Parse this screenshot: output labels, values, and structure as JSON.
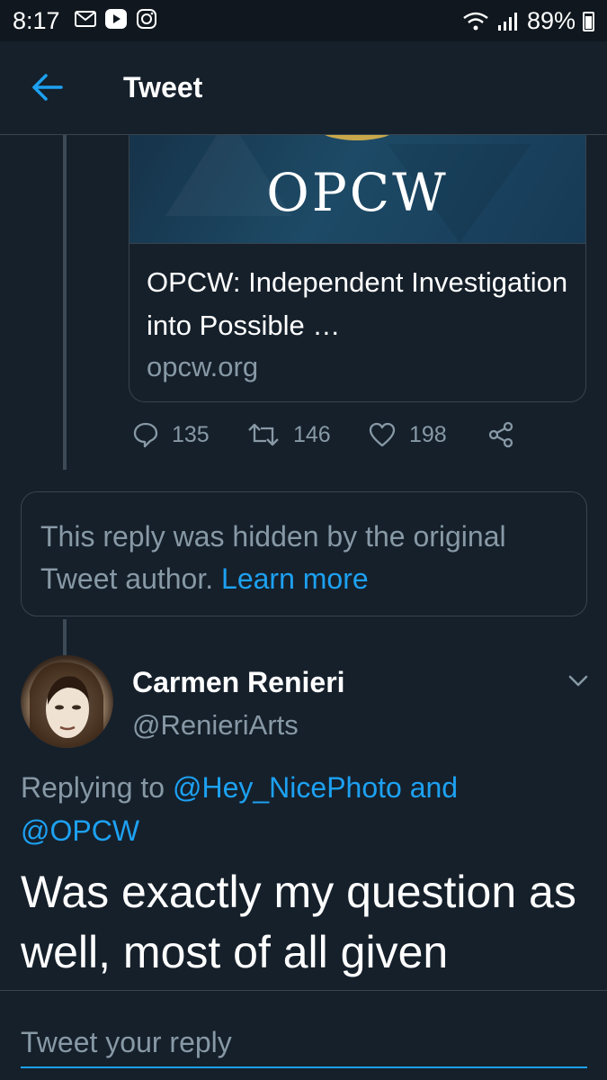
{
  "status_bar": {
    "time": "8:17",
    "battery": "89%",
    "notification_icons": [
      "gmail-icon",
      "play-icon",
      "instagram-icon"
    ]
  },
  "header": {
    "title": "Tweet",
    "back_icon": "arrow-left-icon"
  },
  "link_card": {
    "image_text": "OPCW",
    "title": "OPCW: Independent Investigation into Possible …",
    "domain": "opcw.org"
  },
  "tweet_actions": {
    "replies": "135",
    "retweets": "146",
    "likes": "198"
  },
  "hidden_reply": {
    "message": "This reply was hidden by the original Tweet author.",
    "link": "Learn more"
  },
  "reply_tweet": {
    "author_name": "Carmen Renieri",
    "author_handle": "@RenieriArts",
    "replying_prefix": "Replying to",
    "replying_to": "@Hey_NicePhoto and @OPCW",
    "text": "Was exactly my question as well, most of all given"
  },
  "compose": {
    "placeholder": "Tweet your reply"
  },
  "colors": {
    "background": "#15202b",
    "accent": "#1da1f2",
    "secondary_text": "#8899a6",
    "border": "#38444d"
  }
}
